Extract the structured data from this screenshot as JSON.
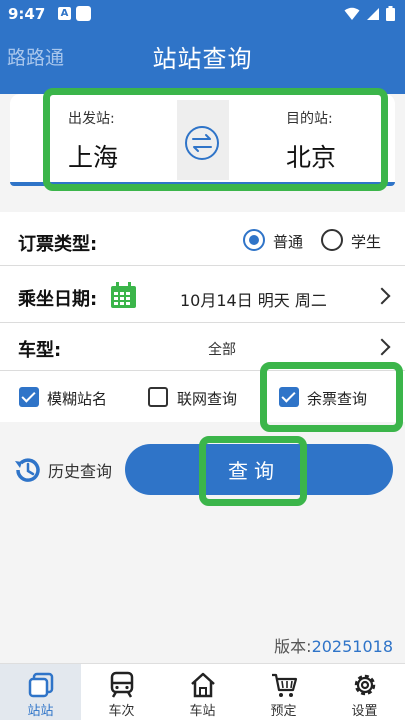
{
  "status_bar": {
    "time": "9:47",
    "notif_letter": "A"
  },
  "app_bar": {
    "brand": "路路通",
    "title": "站站查询"
  },
  "stations": {
    "from_label": "出发站:",
    "from_value": "上海",
    "to_label": "目的站:",
    "to_value": "北京"
  },
  "ticket_type": {
    "label": "订票类型:",
    "options": [
      {
        "label": "普通",
        "selected": true
      },
      {
        "label": "学生",
        "selected": false
      }
    ]
  },
  "travel_date": {
    "label": "乘坐日期:",
    "value": "10月14日 明天 周二"
  },
  "car_type": {
    "label": "车型:",
    "value": "全部"
  },
  "checkboxes": [
    {
      "label": "模糊站名",
      "checked": true
    },
    {
      "label": "联网查询",
      "checked": false
    },
    {
      "label": "余票查询",
      "checked": true
    }
  ],
  "history_label": "历史查询",
  "query_label": "查询",
  "version": {
    "prefix": "版本:",
    "number": "20251018"
  },
  "bottom_nav": [
    {
      "label": "站站",
      "icon": "station-icon",
      "active": true
    },
    {
      "label": "车次",
      "icon": "train-icon",
      "active": false
    },
    {
      "label": "车站",
      "icon": "home-icon",
      "active": false
    },
    {
      "label": "预定",
      "icon": "cart-icon",
      "active": false
    },
    {
      "label": "设置",
      "icon": "gear-icon",
      "active": false
    }
  ],
  "colors": {
    "primary": "#2f74c8",
    "highlight": "#3bb54a"
  }
}
